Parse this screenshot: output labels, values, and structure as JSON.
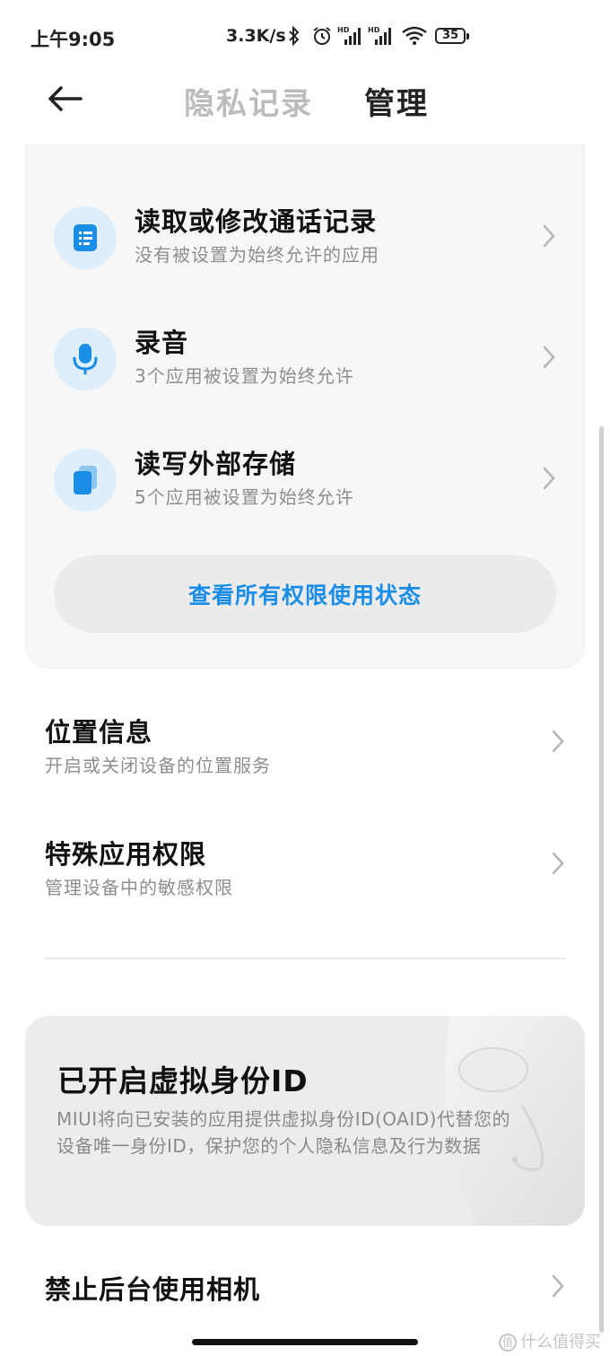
{
  "status_bar": {
    "time": "上午9:05",
    "net_speed": "3.3K/s",
    "battery": "35",
    "icons": [
      "bluetooth-icon",
      "alarm-icon",
      "signal-hd-icon",
      "signal-hd-icon",
      "wifi-icon",
      "battery-icon"
    ]
  },
  "header": {
    "back_icon": "back-arrow-icon",
    "tabs": [
      {
        "label": "隐私记录",
        "active": false
      },
      {
        "label": "管理",
        "active": true
      }
    ]
  },
  "permissions": {
    "items": [
      {
        "title": "读取或修改通话记录",
        "subtitle": "没有被设置为始终允许的应用",
        "icon": "call-log-icon"
      },
      {
        "title": "录音",
        "subtitle": "3个应用被设置为始终允许",
        "icon": "microphone-icon"
      },
      {
        "title": "读写外部存储",
        "subtitle": "5个应用被设置为始终允许",
        "icon": "storage-icon"
      }
    ],
    "view_all_label": "查看所有权限使用状态"
  },
  "settings_rows": [
    {
      "title": "位置信息",
      "subtitle": "开启或关闭设备的位置服务"
    },
    {
      "title": "特殊应用权限",
      "subtitle": "管理设备中的敏感权限"
    }
  ],
  "virtual_id": {
    "title": "已开启虚拟身份ID",
    "description": "MIUI将向已安装的应用提供虚拟身份ID(OAID)代替您的设备唯一身份ID，保护您的个人隐私信息及行为数据"
  },
  "bottom_row": {
    "title": "禁止后台使用相机"
  },
  "watermark": {
    "text": "什么值得买",
    "logo": "值"
  },
  "colors": {
    "accent": "#1a8ee6",
    "icon_circle": "#dfeefb",
    "card_bg": "#f7f7f7",
    "subtitle": "#8e8e8e"
  }
}
